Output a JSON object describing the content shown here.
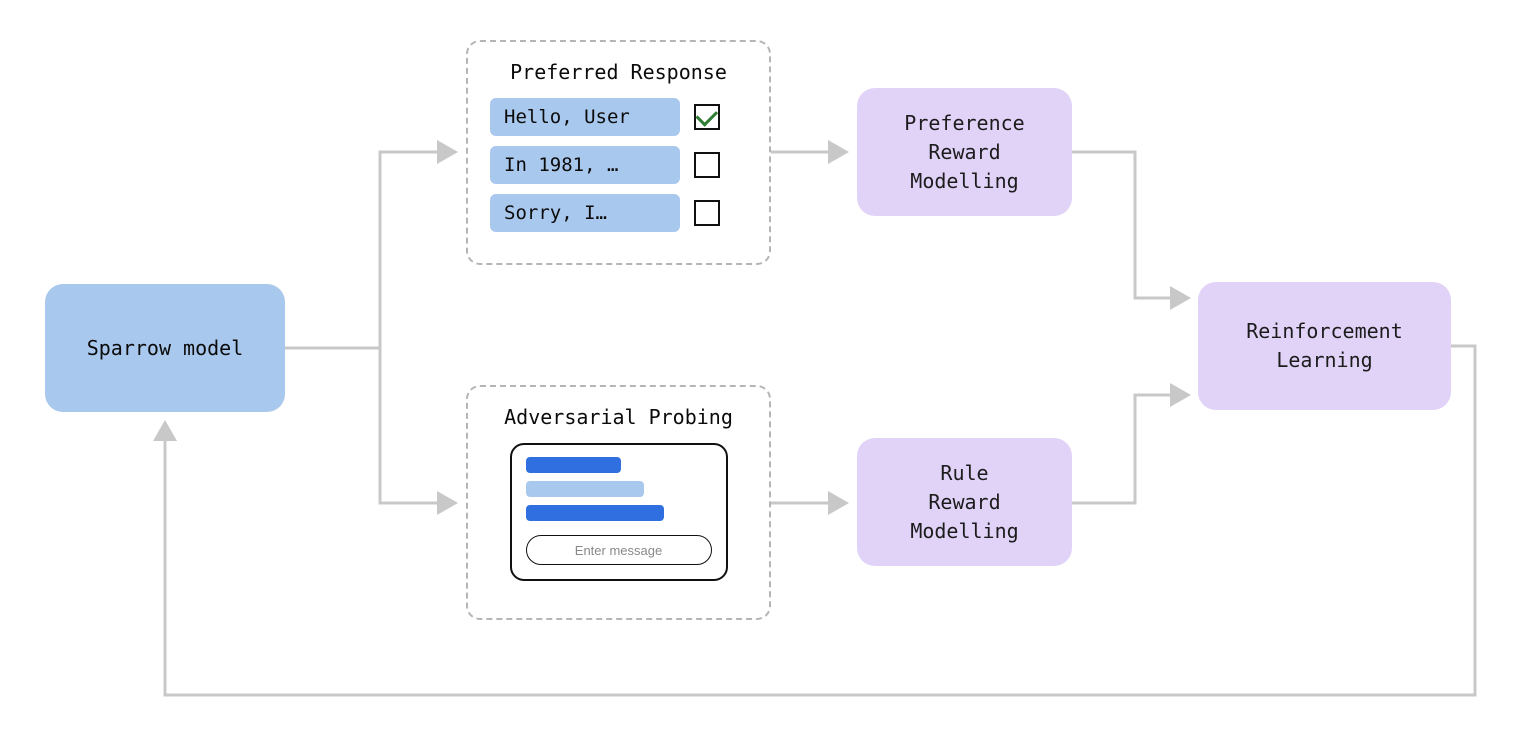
{
  "colors": {
    "node_blue": "#a9c8ed",
    "node_purple": "#e1d3f8",
    "arrow": "#c8c8c8",
    "bar_dark_blue": "#2f6fe0",
    "bar_light_blue": "#a9c8ed",
    "check_green": "#2e7d32"
  },
  "nodes": {
    "sparrow": "Sparrow model",
    "pref_reward": "Preference\nReward\nModelling",
    "rule_reward": "Rule\nReward\nModelling",
    "rl": "Reinforcement\nLearning"
  },
  "preferred_response": {
    "title": "Preferred Response",
    "options": [
      {
        "label": "Hello, User",
        "checked": true
      },
      {
        "label": "In 1981, …",
        "checked": false
      },
      {
        "label": "Sorry, I…",
        "checked": false
      }
    ]
  },
  "adversarial": {
    "title": "Adversarial Probing",
    "chat_placeholder": "Enter message"
  },
  "flow_edges": [
    [
      "sparrow",
      "preferred_response_panel"
    ],
    [
      "sparrow",
      "adversarial_probing_panel"
    ],
    [
      "preferred_response_panel",
      "pref_reward"
    ],
    [
      "adversarial_probing_panel",
      "rule_reward"
    ],
    [
      "pref_reward",
      "rl"
    ],
    [
      "rule_reward",
      "rl"
    ],
    [
      "rl",
      "sparrow"
    ]
  ]
}
